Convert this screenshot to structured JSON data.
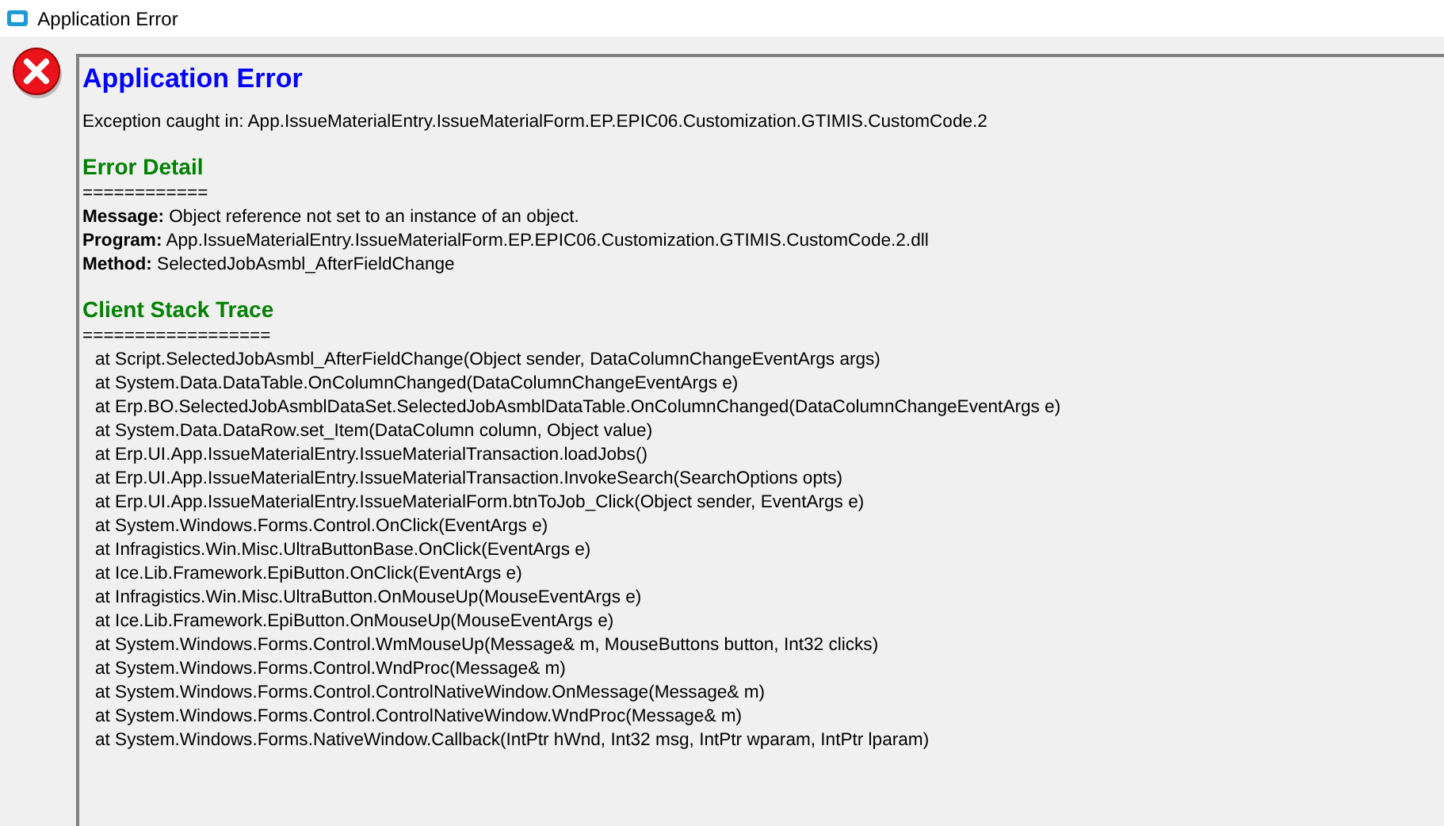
{
  "window": {
    "title": "Application Error"
  },
  "report": {
    "heading": "Application Error",
    "exception": "Exception caught in: App.IssueMaterialEntry.IssueMaterialForm.EP.EPIC06.Customization.GTIMIS.CustomCode.2",
    "error_detail": {
      "heading": "Error Detail",
      "rule": "============",
      "fields": [
        {
          "label": "Message:",
          "value": "Object reference not set to an instance of an object."
        },
        {
          "label": "Program:",
          "value": "App.IssueMaterialEntry.IssueMaterialForm.EP.EPIC06.Customization.GTIMIS.CustomCode.2.dll"
        },
        {
          "label": "Method:",
          "value": "SelectedJobAsmbl_AfterFieldChange"
        }
      ]
    },
    "stack_trace": {
      "heading": "Client Stack Trace",
      "rule": "==================",
      "lines": [
        "at Script.SelectedJobAsmbl_AfterFieldChange(Object sender, DataColumnChangeEventArgs args)",
        "at System.Data.DataTable.OnColumnChanged(DataColumnChangeEventArgs e)",
        "at Erp.BO.SelectedJobAsmblDataSet.SelectedJobAsmblDataTable.OnColumnChanged(DataColumnChangeEventArgs e)",
        "at System.Data.DataRow.set_Item(DataColumn column, Object value)",
        "at Erp.UI.App.IssueMaterialEntry.IssueMaterialTransaction.loadJobs()",
        "at Erp.UI.App.IssueMaterialEntry.IssueMaterialTransaction.InvokeSearch(SearchOptions opts)",
        "at Erp.UI.App.IssueMaterialEntry.IssueMaterialForm.btnToJob_Click(Object sender, EventArgs e)",
        "at System.Windows.Forms.Control.OnClick(EventArgs e)",
        "at Infragistics.Win.Misc.UltraButtonBase.OnClick(EventArgs e)",
        "at Ice.Lib.Framework.EpiButton.OnClick(EventArgs e)",
        "at Infragistics.Win.Misc.UltraButton.OnMouseUp(MouseEventArgs e)",
        "at Ice.Lib.Framework.EpiButton.OnMouseUp(MouseEventArgs e)",
        "at System.Windows.Forms.Control.WmMouseUp(Message& m, MouseButtons button, Int32 clicks)",
        "at System.Windows.Forms.Control.WndProc(Message& m)",
        "at System.Windows.Forms.Control.ControlNativeWindow.OnMessage(Message& m)",
        "at System.Windows.Forms.Control.ControlNativeWindow.WndProc(Message& m)",
        "at System.Windows.Forms.NativeWindow.Callback(IntPtr hWnd, Int32 msg, IntPtr wparam, IntPtr lparam)"
      ]
    }
  }
}
